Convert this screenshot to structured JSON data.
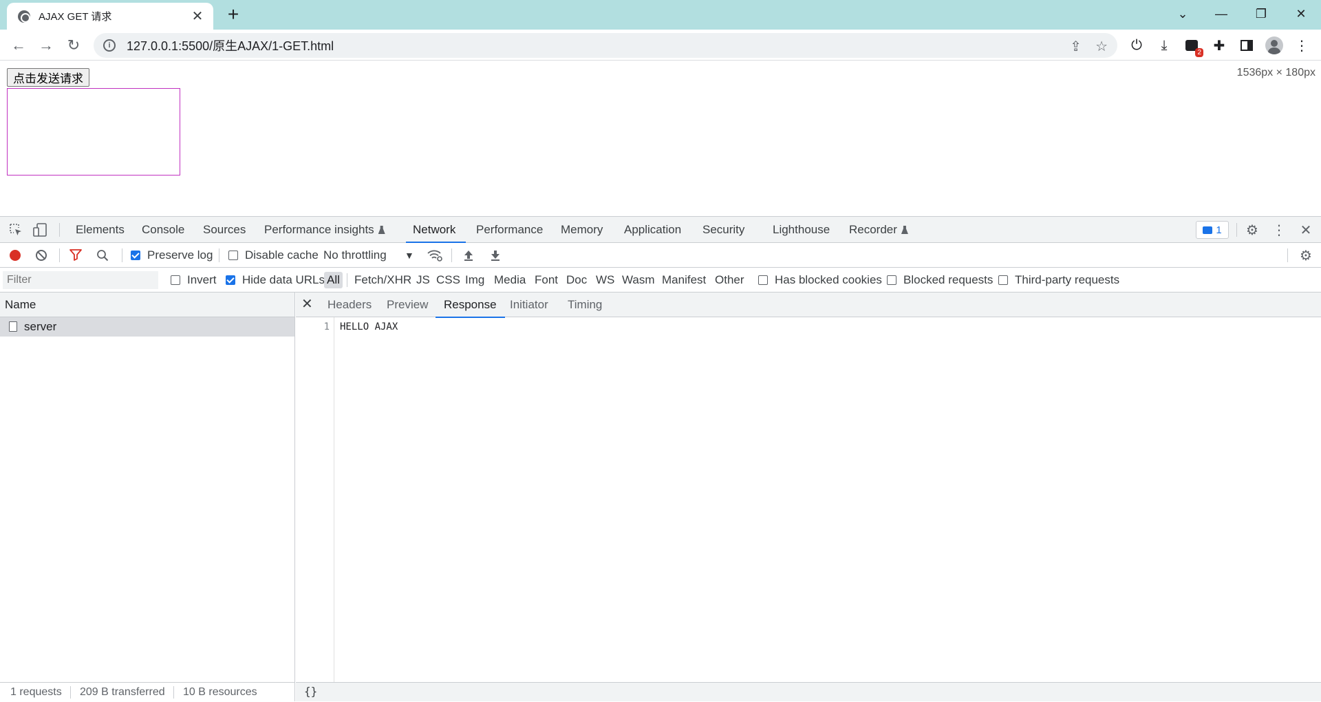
{
  "browser": {
    "tab_title": "AJAX GET 请求",
    "tab_close": "✕",
    "new_tab": "+",
    "url": "127.0.0.1:5500/原生AJAX/1-GET.html",
    "extension_badge": "2"
  },
  "page": {
    "button_label": "点击发送请求",
    "dimensions_overlay": "1536px × 180px"
  },
  "devtools": {
    "tabs": [
      {
        "label": "Elements"
      },
      {
        "label": "Console"
      },
      {
        "label": "Sources"
      },
      {
        "label": "Performance insights"
      },
      {
        "label": "Network"
      },
      {
        "label": "Performance"
      },
      {
        "label": "Memory"
      },
      {
        "label": "Application"
      },
      {
        "label": "Security"
      },
      {
        "label": "Lighthouse"
      },
      {
        "label": "Recorder"
      }
    ],
    "active_tab": "Network",
    "issues_count": "1",
    "network_toolbar": {
      "preserve_log": "Preserve log",
      "disable_cache": "Disable cache",
      "throttling": "No throttling"
    },
    "filter": {
      "placeholder": "Filter",
      "invert": "Invert",
      "hide_data_urls": "Hide data URLs",
      "types": [
        "All",
        "Fetch/XHR",
        "JS",
        "CSS",
        "Img",
        "Media",
        "Font",
        "Doc",
        "WS",
        "Wasm",
        "Manifest",
        "Other"
      ],
      "has_blocked_cookies": "Has blocked cookies",
      "blocked_requests": "Blocked requests",
      "third_party": "Third-party requests"
    },
    "requests": {
      "column_name": "Name",
      "rows": [
        {
          "name": "server"
        }
      ]
    },
    "status": {
      "requests": "1 requests",
      "transferred": "209 B transferred",
      "resources": "10 B resources"
    },
    "detail": {
      "close": "✕",
      "tabs": [
        "Headers",
        "Preview",
        "Response",
        "Initiator",
        "Timing"
      ],
      "active": "Response",
      "line_number": "1",
      "response_text": "HELLO AJAX",
      "pretty_print": "{}"
    }
  }
}
